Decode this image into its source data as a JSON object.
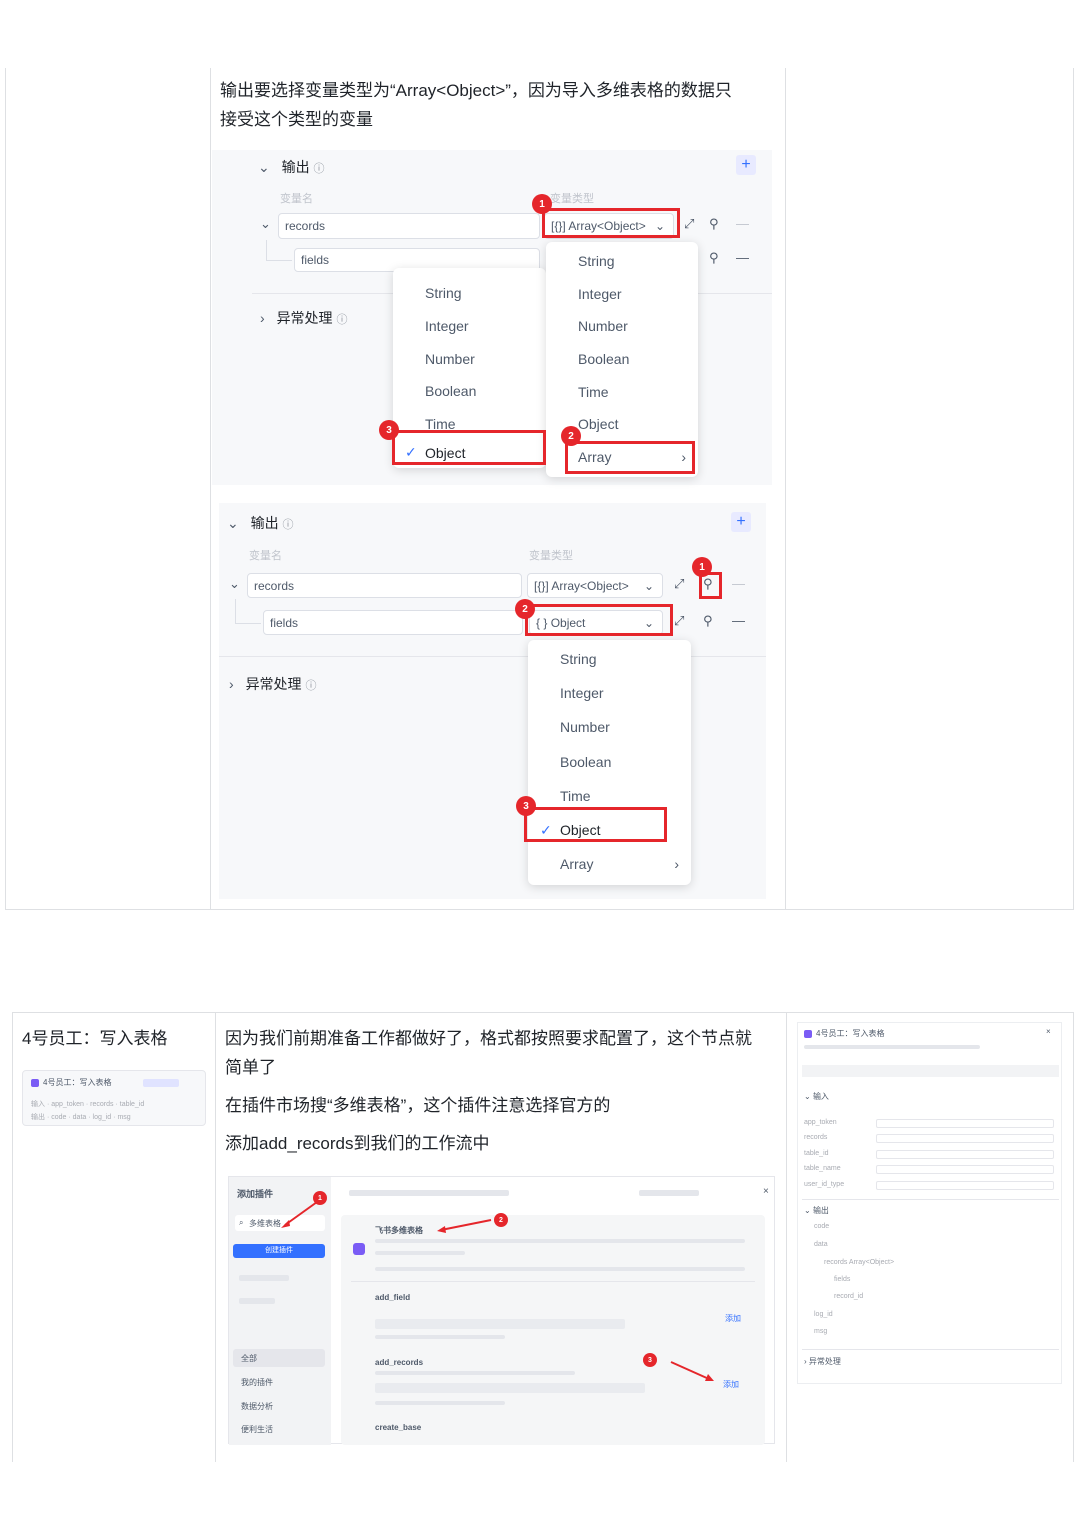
{
  "section1": {
    "description_line1": "输出要选择变量类型为“Array<Object>”，因为导入多维表格的数据只",
    "description_line2": "接受这个类型的变量",
    "panel_a": {
      "output_title": "输出",
      "col_name_label": "变量名",
      "col_type_label": "变量类型",
      "records_value": "records",
      "fields_value": "fields",
      "records_type": "Array<Object>",
      "records_type_prefix": "[{}]",
      "exception_title": "异常处理",
      "menu_left": [
        "String",
        "Integer",
        "Number",
        "Boolean",
        "Time",
        "Object"
      ],
      "menu_right": [
        "String",
        "Integer",
        "Number",
        "Boolean",
        "Time",
        "Object",
        "Array"
      ],
      "badges": [
        "1",
        "2",
        "3"
      ]
    },
    "panel_b": {
      "output_title": "输出",
      "col_name_label": "变量名",
      "col_type_label": "变量类型",
      "records_value": "records",
      "fields_value": "fields",
      "records_type": "Array<Object>",
      "records_type_prefix": "[{}]",
      "fields_type": "Object",
      "fields_type_prefix": "{ }",
      "exception_title": "异常处理",
      "menu": [
        "String",
        "Integer",
        "Number",
        "Boolean",
        "Time",
        "Object",
        "Array"
      ],
      "badges": [
        "1",
        "2",
        "3"
      ]
    }
  },
  "section2": {
    "step_title": "4号员工：写入表格",
    "thumb_left": {
      "node_title": "4号员工：写入表格",
      "row1": [
        "输入",
        "app_token",
        "records",
        "table_id"
      ],
      "row2": [
        "输出",
        "code",
        "data",
        "log_id",
        "msg"
      ]
    },
    "para1_line1": "因为我们前期准备工作都做好了，格式都按照要求配置了，这个节点就",
    "para1_line2": "简单了",
    "para2": "在插件市场搜“多维表格”，这个插件注意选择官方的",
    "para3": "添加add_records到我们的工作流中",
    "plugin_dialog": {
      "title": "添加插件",
      "search_value": "多维表格",
      "create_button": "创建插件",
      "sidebar_items": [
        "全部",
        "我的插件",
        "数据分析",
        "便利生活"
      ],
      "main_items": [
        "飞书多维表格",
        "add_field",
        "add_records",
        "create_base"
      ],
      "add_button": "添加",
      "badges": [
        "1",
        "2",
        "3"
      ]
    },
    "thumb_right": {
      "node_title": "4号员工：写入表格",
      "input_title": "输入",
      "input_params": [
        "app_token",
        "records",
        "table_id",
        "table_name",
        "user_id_type"
      ],
      "output_title": "输出",
      "output_params": [
        "code",
        "data",
        "records",
        "fields",
        "record_id",
        "log_id",
        "msg"
      ],
      "records_type": "Array<Object>",
      "exception_title": "异常处理"
    }
  },
  "colors": {
    "accent_red": "#e5262b",
    "accent_blue": "#3370ff",
    "panel_bg": "#f7f8fa"
  }
}
